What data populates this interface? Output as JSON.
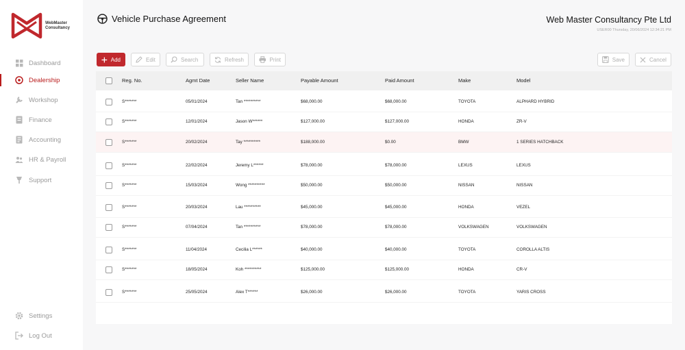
{
  "brand": {
    "name_line1": "WebMaster",
    "name_line2": "Consultancy",
    "accent": "#c0282d"
  },
  "sidebar": {
    "items": [
      {
        "label": "Dashboard",
        "icon": "dashboard-icon"
      },
      {
        "label": "Dealership",
        "icon": "dealership-icon",
        "active": true
      },
      {
        "label": "Workshop",
        "icon": "workshop-icon"
      },
      {
        "label": "Finance",
        "icon": "finance-icon"
      },
      {
        "label": "Accounting",
        "icon": "accounting-icon"
      },
      {
        "label": "HR & Payroll",
        "icon": "hr-icon"
      },
      {
        "label": "Support",
        "icon": "support-icon"
      }
    ],
    "bottom": [
      {
        "label": "Settings",
        "icon": "gear-icon"
      },
      {
        "label": "Log Out",
        "icon": "logout-icon"
      }
    ]
  },
  "header": {
    "title": "Vehicle Purchase Agreement",
    "company": "Web Master Consultancy Pte Ltd",
    "userline": "USER00 Thursday, 20/06/2024 12:34:21 PM"
  },
  "toolbar": {
    "add": "Add",
    "edit": "Edit",
    "search": "Search",
    "refresh": "Refresh",
    "print": "Print",
    "save": "Save",
    "cancel": "Cancel"
  },
  "table": {
    "columns": [
      "Reg. No.",
      "Agmt Date",
      "Seller Name",
      "Payable Amount",
      "Paid Amount",
      "Make",
      "Model"
    ],
    "rows": [
      [
        "S*******",
        "05/01/2024",
        "Tan **********",
        "$68,000.00",
        "$68,000.00",
        "TOYOTA",
        "ALPHARD HYBRID"
      ],
      [
        "S*******",
        "12/01/2024",
        "Jason W******",
        "$127,000.00",
        "$127,000.00",
        "HONDA",
        "ZR-V"
      ],
      [
        "S*******",
        "20/02/2024",
        "Tay **********",
        "$188,000.00",
        "$0.00",
        "BMW",
        "1 SERIES HATCHBACK"
      ],
      [
        "S*******",
        "22/02/2024",
        "Jeremy L******",
        "$78,000.00",
        "$78,000.00",
        "LEXUS",
        "LEXUS"
      ],
      [
        "S*******",
        "15/03/2024",
        "Wong **********",
        "$50,000.00",
        "$50,000.00",
        "NISSAN",
        "NISSAN"
      ],
      [
        "S*******",
        "20/03/2024",
        "Lau **********",
        "$45,000.00",
        "$45,000.00",
        "HONDA",
        "VEZEL"
      ],
      [
        "S*******",
        "07/04/2024",
        "Tan **********",
        "$78,000.00",
        "$78,000.00",
        "VOLKSWAGEN",
        "VOLKSWAGEN"
      ],
      [
        "S*******",
        "11/04/2024",
        "Cecilia L******",
        "$40,000.00",
        "$40,000.00",
        "TOYOTA",
        "COROLLA ALTIS"
      ],
      [
        "S*******",
        "18/05/2024",
        "Koh **********",
        "$125,000.00",
        "$125,000.00",
        "HONDA",
        "CR-V"
      ],
      [
        "S*******",
        "25/05/2024",
        "Alex T******",
        "$26,000.00",
        "$26,000.00",
        "TOYOTA",
        "YARIS CROSS"
      ]
    ],
    "highlighted_row": 2
  }
}
